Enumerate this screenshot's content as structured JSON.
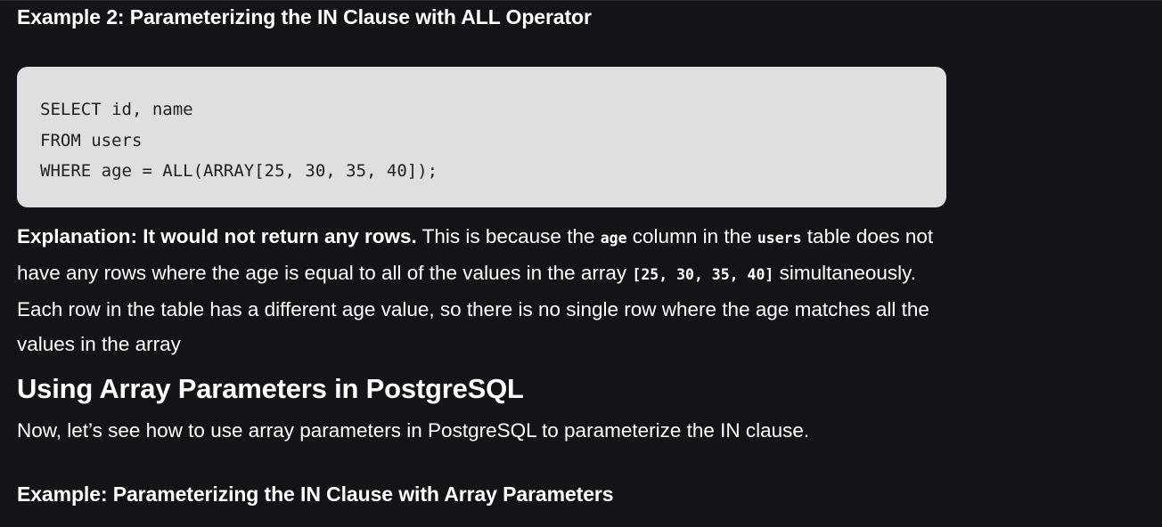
{
  "article": {
    "example2_heading": "Example 2: Parameterizing the IN Clause with ALL Operator",
    "code_lines": [
      "SELECT id, name",
      "FROM users",
      "WHERE age = ALL(ARRAY[25, 30, 35, 40]);"
    ],
    "explanation": {
      "label": "Explanation: It would not return any rows.",
      "text1": " This is because the ",
      "code1": "age",
      "text2": " column in the ",
      "code2": "users",
      "text3": " table does not have any rows where the age is equal to all of the values in the array ",
      "code3": "[25, 30, 35, 40]",
      "text4": " simultaneously. Each row in the table has a different age value, so there is no single row where the age matches all the values in the array"
    },
    "section_heading": "Using Array Parameters in PostgreSQL",
    "section_intro": "Now, let’s see how to use array parameters in PostgreSQL to parameterize the IN clause.",
    "example3_heading": "Example: Parameterizing the IN Clause with Array Parameters"
  }
}
